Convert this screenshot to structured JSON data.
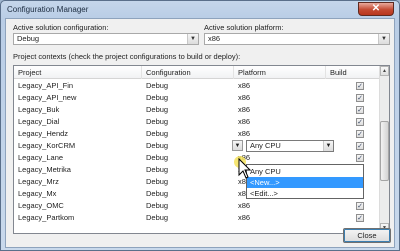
{
  "window": {
    "title": "Configuration Manager",
    "close_glyph": "✕"
  },
  "solution_config": {
    "label": "Active solution configuration:",
    "value": "Debug"
  },
  "solution_platform": {
    "label": "Active solution platform:",
    "value": "x86"
  },
  "contexts_label": "Project contexts (check the project configurations to build or deploy):",
  "grid": {
    "columns": [
      "Project",
      "Configuration",
      "Platform",
      "Build"
    ],
    "rows": [
      {
        "project": "Legacy_API_Fin",
        "configuration": "Debug",
        "platform": "x86",
        "build": true
      },
      {
        "project": "Legacy_API_new",
        "configuration": "Debug",
        "platform": "x86",
        "build": true
      },
      {
        "project": "Legacy_Buk",
        "configuration": "Debug",
        "platform": "x86",
        "build": true
      },
      {
        "project": "Legacy_Dial",
        "configuration": "Debug",
        "platform": "x86",
        "build": true
      },
      {
        "project": "Legacy_Hendz",
        "configuration": "Debug",
        "platform": "x86",
        "build": true
      },
      {
        "project": "Legacy_KorCRM",
        "configuration": "Debug",
        "platform": "Any CPU",
        "build": true
      },
      {
        "project": "Legacy_Lane",
        "configuration": "Debug",
        "platform": "x86",
        "build": true
      },
      {
        "project": "Legacy_Metrika",
        "configuration": "Debug",
        "platform": "x86",
        "build": true
      },
      {
        "project": "Legacy_Mrz",
        "configuration": "Debug",
        "platform": "x86",
        "build": true
      },
      {
        "project": "Legacy_Mx",
        "configuration": "Debug",
        "platform": "x86",
        "build": true
      },
      {
        "project": "Legacy_OMC",
        "configuration": "Debug",
        "platform": "x86",
        "build": true
      },
      {
        "project": "Legacy_Partkom",
        "configuration": "Debug",
        "platform": "x86",
        "build": true
      }
    ]
  },
  "platform_dropdown": {
    "options": [
      "Any CPU",
      "<New...>",
      "<Edit...>"
    ],
    "selected": "<New...>"
  },
  "icons": {
    "dropdown_arrow": "▼",
    "scroll_up": "▲",
    "scroll_down": "▼",
    "check": "✓"
  },
  "close_button": "Close",
  "colors": {
    "selection": "#3399ff",
    "close_red": "#c44a32"
  }
}
